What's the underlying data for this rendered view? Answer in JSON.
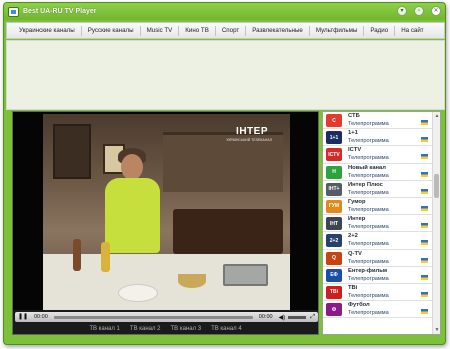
{
  "window": {
    "title": "Best UA-RU TV Player"
  },
  "menu": {
    "items": [
      {
        "label": "Украинские каналы"
      },
      {
        "label": "Русские каналы"
      },
      {
        "label": "Music TV"
      },
      {
        "label": "Кино ТВ"
      },
      {
        "label": "Спорт"
      },
      {
        "label": "Развлекательные"
      },
      {
        "label": "Мультфильмы"
      },
      {
        "label": "Радио"
      },
      {
        "label": "На сайт"
      }
    ]
  },
  "player": {
    "watermark": "ІНТЕР",
    "watermark_sub": "УКРАЇНСЬКИЙ ТЕЛЕКАНАЛ",
    "time_elapsed": "00:00",
    "time_total": "00:00",
    "channel_tabs": [
      {
        "label": "ТВ канал 1"
      },
      {
        "label": "ТВ канал 2"
      },
      {
        "label": "ТВ канал 3"
      },
      {
        "label": "ТВ канал 4"
      }
    ]
  },
  "channels": [
    {
      "name": "СТБ",
      "subtitle": "Телепрограмма",
      "logo": "С",
      "color": "#e33b2e"
    },
    {
      "name": "1+1",
      "subtitle": "Телепрограмма",
      "logo": "1+1",
      "color": "#1b2c63"
    },
    {
      "name": "ICTV",
      "subtitle": "Телепрограмма",
      "logo": "ICTV",
      "color": "#d42a2a"
    },
    {
      "name": "Новый канал",
      "subtitle": "Телепрограмма",
      "logo": "Н",
      "color": "#2fa33b"
    },
    {
      "name": "Интер Плюс",
      "subtitle": "Телепрограмма",
      "logo": "ІНТ+",
      "color": "#555c66"
    },
    {
      "name": "Гумор",
      "subtitle": "Телепрограмма",
      "logo": "ГУМ",
      "color": "#e08a1c"
    },
    {
      "name": "Интер",
      "subtitle": "Телепрограмма",
      "logo": "ІНТ",
      "color": "#3d4652"
    },
    {
      "name": "2+2",
      "subtitle": "Телепрограмма",
      "logo": "2+2",
      "color": "#27406e"
    },
    {
      "name": "Q-TV",
      "subtitle": "Телепрограмма",
      "logo": "Q",
      "color": "#c64412"
    },
    {
      "name": "Ентер-фильм",
      "subtitle": "Телепрограмма",
      "logo": "ЕФ",
      "color": "#1a4fa8"
    },
    {
      "name": "ТВі",
      "subtitle": "Телепрограмма",
      "logo": "ТВі",
      "color": "#cc1f1f"
    },
    {
      "name": "Футбол",
      "subtitle": "Телепрограмма",
      "logo": "Ф",
      "color": "#8a1a8a"
    }
  ],
  "colors": {
    "accent": "#7dc13a",
    "tab_text": "#a9b2c3",
    "subtitle_link": "#29466b"
  }
}
